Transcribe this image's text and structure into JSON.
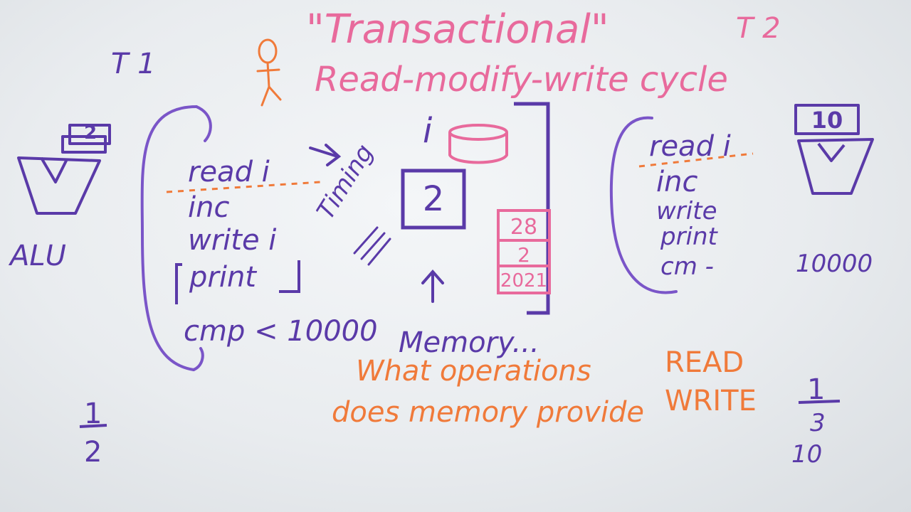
{
  "colors": {
    "board": "#eceff1",
    "purple_marker": "#5a3aa8",
    "pink_marker": "#e86a9c",
    "orange_marker": "#f07a3a"
  },
  "title": {
    "quoted": "\"Transactional\"",
    "subtitle": "Read-modify-write cycle"
  },
  "threads": {
    "t1": "T 1",
    "t2": "T 2"
  },
  "left": {
    "alu_label": "ALU",
    "alu_register": "2",
    "code_lines": [
      "read i",
      "inc",
      "write i",
      "print",
      "cmp < 10000"
    ],
    "fraction_top": "1",
    "fraction_bottom": "2"
  },
  "center": {
    "variable": "i",
    "memory_value": "2",
    "timing_label": "Timing",
    "memory_label": "Memory...",
    "date_cells": [
      "28",
      "2",
      "2021"
    ]
  },
  "right": {
    "register": "10",
    "code_lines": [
      "read i",
      "inc",
      "write",
      "print",
      "cm -"
    ],
    "count": "10000",
    "fraction_top": "1",
    "fraction_mid": "3",
    "fraction_bottom": "10"
  },
  "question": {
    "line1": "What operations",
    "line1_op": "READ",
    "line2": "does memory provide",
    "line2_op": "WRITE"
  }
}
